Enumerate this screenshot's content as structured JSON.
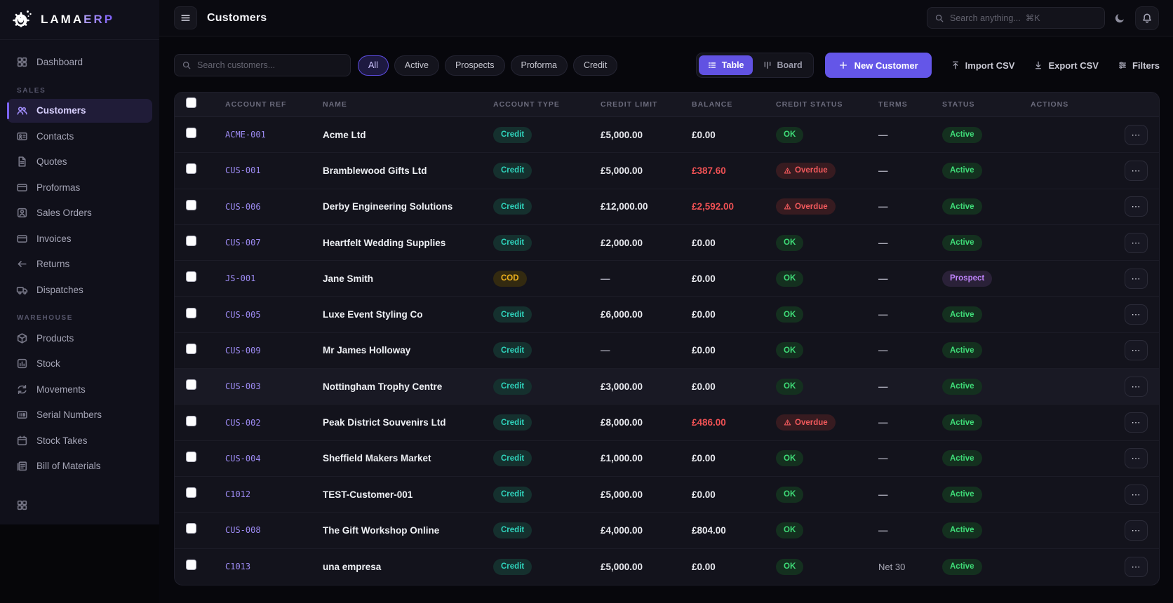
{
  "brand": {
    "name_primary": "LAMA",
    "name_accent": "ERP"
  },
  "topbar": {
    "title": "Customers",
    "search_placeholder": "Search anything...  ⌘K",
    "icons": [
      "menu-icon",
      "search-icon",
      "moon-icon",
      "bell-icon"
    ]
  },
  "sidebar": {
    "top_items": [
      {
        "label": "Dashboard",
        "icon": "grid"
      }
    ],
    "sections": [
      {
        "label": "SALES",
        "items": [
          {
            "label": "Customers",
            "icon": "users",
            "active": true
          },
          {
            "label": "Contacts",
            "icon": "id-card"
          },
          {
            "label": "Quotes",
            "icon": "file-text"
          },
          {
            "label": "Proformas",
            "icon": "credit-card"
          },
          {
            "label": "Sales Orders",
            "icon": "user-square"
          },
          {
            "label": "Invoices",
            "icon": "credit-card"
          },
          {
            "label": "Returns",
            "icon": "arrow-left"
          },
          {
            "label": "Dispatches",
            "icon": "truck"
          }
        ]
      },
      {
        "label": "WAREHOUSE",
        "items": [
          {
            "label": "Products",
            "icon": "box"
          },
          {
            "label": "Stock",
            "icon": "chart-bar"
          },
          {
            "label": "Movements",
            "icon": "repeat"
          },
          {
            "label": "Serial Numbers",
            "icon": "barcode-card"
          },
          {
            "label": "Stock Takes",
            "icon": "calendar"
          },
          {
            "label": "Bill of Materials",
            "icon": "file-stack"
          },
          {
            "label": "",
            "icon": "grid",
            "clipped": true
          }
        ]
      }
    ]
  },
  "toolbar": {
    "search_placeholder": "Search customers...",
    "filter_pills": [
      "All",
      "Active",
      "Prospects",
      "Proforma",
      "Credit"
    ],
    "active_pill": "All",
    "view_options": [
      {
        "label": "Table",
        "icon": "list",
        "active": true
      },
      {
        "label": "Board",
        "icon": "columns",
        "active": false
      }
    ],
    "new_customer_label": "New Customer",
    "import_label": "Import CSV",
    "export_label": "Export CSV",
    "filters_label": "Filters"
  },
  "table": {
    "columns": [
      "Account Ref",
      "Name",
      "Account Type",
      "Credit Limit",
      "Balance",
      "Credit Status",
      "Terms",
      "Status",
      "Actions"
    ],
    "rows": [
      {
        "ref": "ACME-001",
        "name": "Acme Ltd",
        "account_type": "Credit",
        "credit_limit": "£5,000.00",
        "balance": "£0.00",
        "balance_overdue": false,
        "credit_status": "OK",
        "terms": "—",
        "status": "Active",
        "highlight": false
      },
      {
        "ref": "CUS-001",
        "name": "Bramblewood Gifts Ltd",
        "account_type": "Credit",
        "credit_limit": "£5,000.00",
        "balance": "£387.60",
        "balance_overdue": true,
        "credit_status": "Overdue",
        "terms": "—",
        "status": "Active",
        "highlight": false
      },
      {
        "ref": "CUS-006",
        "name": "Derby Engineering Solutions",
        "account_type": "Credit",
        "credit_limit": "£12,000.00",
        "balance": "£2,592.00",
        "balance_overdue": true,
        "credit_status": "Overdue",
        "terms": "—",
        "status": "Active",
        "highlight": false
      },
      {
        "ref": "CUS-007",
        "name": "Heartfelt Wedding Supplies",
        "account_type": "Credit",
        "credit_limit": "£2,000.00",
        "balance": "£0.00",
        "balance_overdue": false,
        "credit_status": "OK",
        "terms": "—",
        "status": "Active",
        "highlight": false
      },
      {
        "ref": "JS-001",
        "name": "Jane Smith",
        "account_type": "COD",
        "credit_limit": "—",
        "balance": "£0.00",
        "balance_overdue": false,
        "credit_status": "OK",
        "terms": "—",
        "status": "Prospect",
        "highlight": false
      },
      {
        "ref": "CUS-005",
        "name": "Luxe Event Styling Co",
        "account_type": "Credit",
        "credit_limit": "£6,000.00",
        "balance": "£0.00",
        "balance_overdue": false,
        "credit_status": "OK",
        "terms": "—",
        "status": "Active",
        "highlight": false
      },
      {
        "ref": "CUS-009",
        "name": "Mr James Holloway",
        "account_type": "Credit",
        "credit_limit": "—",
        "balance": "£0.00",
        "balance_overdue": false,
        "credit_status": "OK",
        "terms": "—",
        "status": "Active",
        "highlight": false
      },
      {
        "ref": "CUS-003",
        "name": "Nottingham Trophy Centre",
        "account_type": "Credit",
        "credit_limit": "£3,000.00",
        "balance": "£0.00",
        "balance_overdue": false,
        "credit_status": "OK",
        "terms": "—",
        "status": "Active",
        "highlight": true
      },
      {
        "ref": "CUS-002",
        "name": "Peak District Souvenirs Ltd",
        "account_type": "Credit",
        "credit_limit": "£8,000.00",
        "balance": "£486.00",
        "balance_overdue": true,
        "credit_status": "Overdue",
        "terms": "—",
        "status": "Active",
        "highlight": false
      },
      {
        "ref": "CUS-004",
        "name": "Sheffield Makers Market",
        "account_type": "Credit",
        "credit_limit": "£1,000.00",
        "balance": "£0.00",
        "balance_overdue": false,
        "credit_status": "OK",
        "terms": "—",
        "status": "Active",
        "highlight": false
      },
      {
        "ref": "C1012",
        "name": "TEST-Customer-001",
        "account_type": "Credit",
        "credit_limit": "£5,000.00",
        "balance": "£0.00",
        "balance_overdue": false,
        "credit_status": "OK",
        "terms": "—",
        "status": "Active",
        "highlight": false
      },
      {
        "ref": "CUS-008",
        "name": "The Gift Workshop Online",
        "account_type": "Credit",
        "credit_limit": "£4,000.00",
        "balance": "£804.00",
        "balance_overdue": false,
        "credit_status": "OK",
        "terms": "—",
        "status": "Active",
        "highlight": false
      },
      {
        "ref": "C1013",
        "name": "una empresa",
        "account_type": "Credit",
        "credit_limit": "£5,000.00",
        "balance": "£0.00",
        "balance_overdue": false,
        "credit_status": "OK",
        "terms": "Net 30",
        "status": "Active",
        "highlight": false
      }
    ],
    "row_action_label": "⋯"
  },
  "colors": {
    "accent_purple": "#6456e8",
    "ref_purple": "#9d8bf3",
    "teal_credit": "#2fd3bc",
    "green_ok": "#3fdc78",
    "red_overdue": "#f2595c",
    "amber_cod": "#f0b31c",
    "violet_prospect": "#c084fc"
  }
}
